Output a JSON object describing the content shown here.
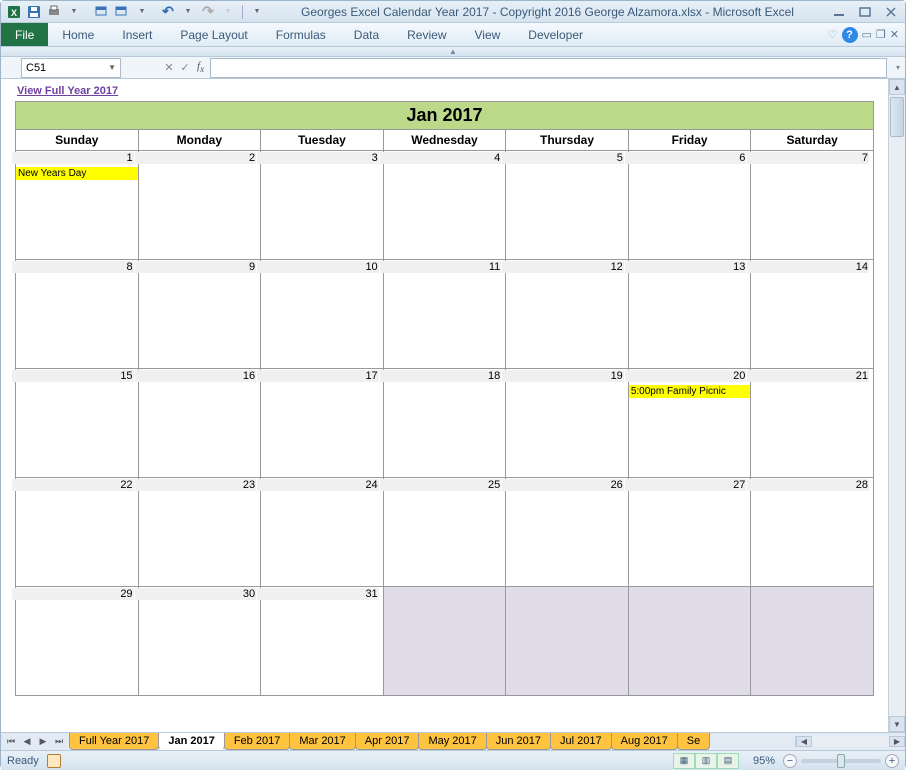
{
  "title": "Georges Excel Calendar Year 2017 - Copyright 2016 George Alzamora.xlsx  -  Microsoft Excel",
  "ribbon": {
    "file": "File",
    "tabs": [
      "Home",
      "Insert",
      "Page Layout",
      "Formulas",
      "Data",
      "Review",
      "View",
      "Developer"
    ]
  },
  "namebox": "C51",
  "link": "View Full Year 2017",
  "calendar": {
    "title": "Jan 2017",
    "days": [
      "Sunday",
      "Monday",
      "Tuesday",
      "Wednesday",
      "Thursday",
      "Friday",
      "Saturday"
    ],
    "weeks": [
      [
        {
          "n": 1,
          "ev": "New Years Day"
        },
        {
          "n": 2
        },
        {
          "n": 3
        },
        {
          "n": 4
        },
        {
          "n": 5
        },
        {
          "n": 6
        },
        {
          "n": 7
        }
      ],
      [
        {
          "n": 8
        },
        {
          "n": 9
        },
        {
          "n": 10
        },
        {
          "n": 11
        },
        {
          "n": 12
        },
        {
          "n": 13
        },
        {
          "n": 14
        }
      ],
      [
        {
          "n": 15
        },
        {
          "n": 16
        },
        {
          "n": 17
        },
        {
          "n": 18
        },
        {
          "n": 19
        },
        {
          "n": 20,
          "ev": "5:00pm Family Picnic"
        },
        {
          "n": 21
        }
      ],
      [
        {
          "n": 22
        },
        {
          "n": 23
        },
        {
          "n": 24
        },
        {
          "n": 25
        },
        {
          "n": 26
        },
        {
          "n": 27
        },
        {
          "n": 28
        }
      ],
      [
        {
          "n": 29
        },
        {
          "n": 30
        },
        {
          "n": 31
        },
        {
          "empty": true
        },
        {
          "empty": true
        },
        {
          "empty": true
        },
        {
          "empty": true
        }
      ]
    ]
  },
  "sheet_tabs": {
    "list": [
      "Full Year 2017",
      "Jan 2017",
      "Feb 2017",
      "Mar 2017",
      "Apr 2017",
      "May 2017",
      "Jun 2017",
      "Jul 2017",
      "Aug 2017",
      "Se"
    ],
    "active_index": 1
  },
  "status": {
    "ready": "Ready",
    "zoom": "95%"
  }
}
